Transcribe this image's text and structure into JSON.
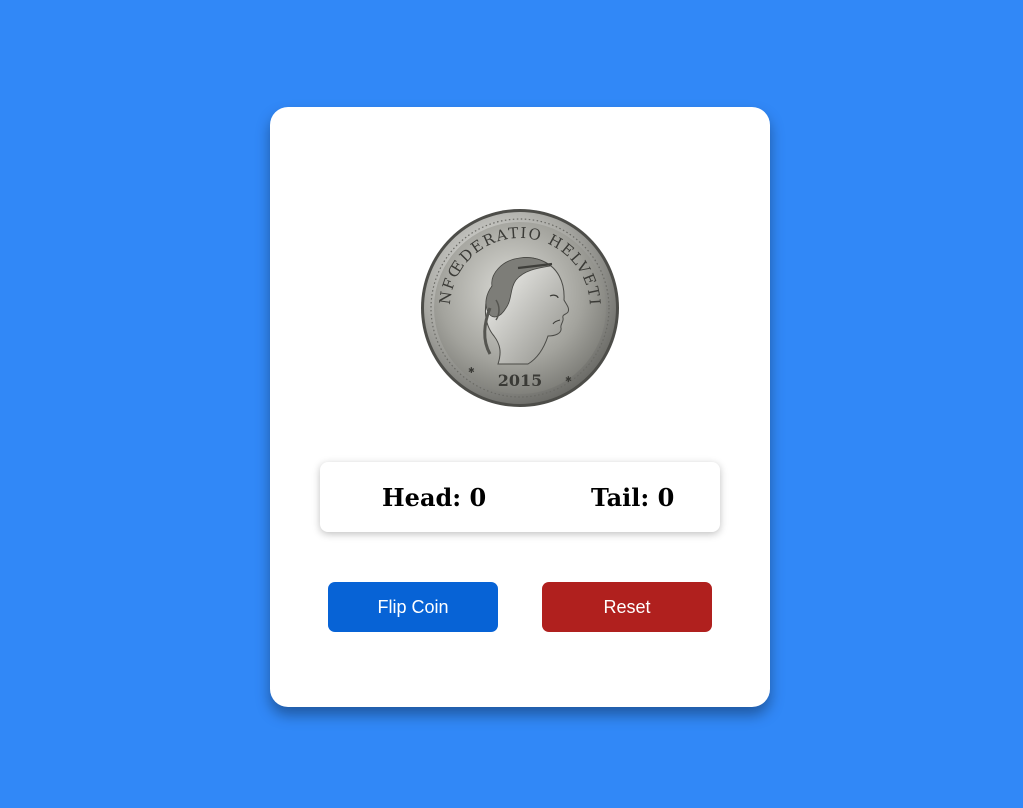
{
  "coin": {
    "inscription_top": "CONFŒDERATIO HELVETICA",
    "year": "2015"
  },
  "scores": {
    "head_label": "Head: 0",
    "tail_label": "Tail: 0",
    "head": 0,
    "tail": 0
  },
  "buttons": {
    "flip_label": "Flip Coin",
    "reset_label": "Reset"
  },
  "colors": {
    "background": "#3188f7",
    "flip_button": "#0763d6",
    "reset_button": "#b0201e"
  }
}
